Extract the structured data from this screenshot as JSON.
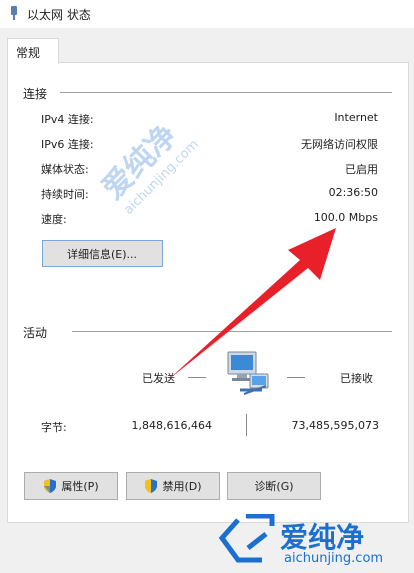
{
  "window": {
    "title": "以太网 状态"
  },
  "tabs": [
    {
      "label": "常规"
    }
  ],
  "connection": {
    "heading": "连接",
    "rows": [
      {
        "label": "IPv4 连接:",
        "value": "Internet"
      },
      {
        "label": "IPv6 连接:",
        "value": "无网络访问权限"
      },
      {
        "label": "媒体状态:",
        "value": "已启用"
      },
      {
        "label": "持续时间:",
        "value": "02:36:50"
      },
      {
        "label": "速度:",
        "value": "100.0 Mbps"
      }
    ],
    "details_button": "详细信息(E)..."
  },
  "activity": {
    "heading": "活动",
    "sent_label": "已发送",
    "received_label": "已接收",
    "bytes_label": "字节:",
    "bytes_sent": "1,848,616,464",
    "bytes_received": "73,485,595,073"
  },
  "buttons": {
    "properties": "属性(P)",
    "disable": "禁用(D)",
    "diagnose": "诊断(G)"
  },
  "watermark": {
    "brand": "爱纯净",
    "url": "aichunjing.com"
  },
  "colors": {
    "arrow": "#e8202a",
    "watermark": "#1a6fd1",
    "shield_blue": "#2a6fc9",
    "shield_yellow": "#f2c21b"
  }
}
